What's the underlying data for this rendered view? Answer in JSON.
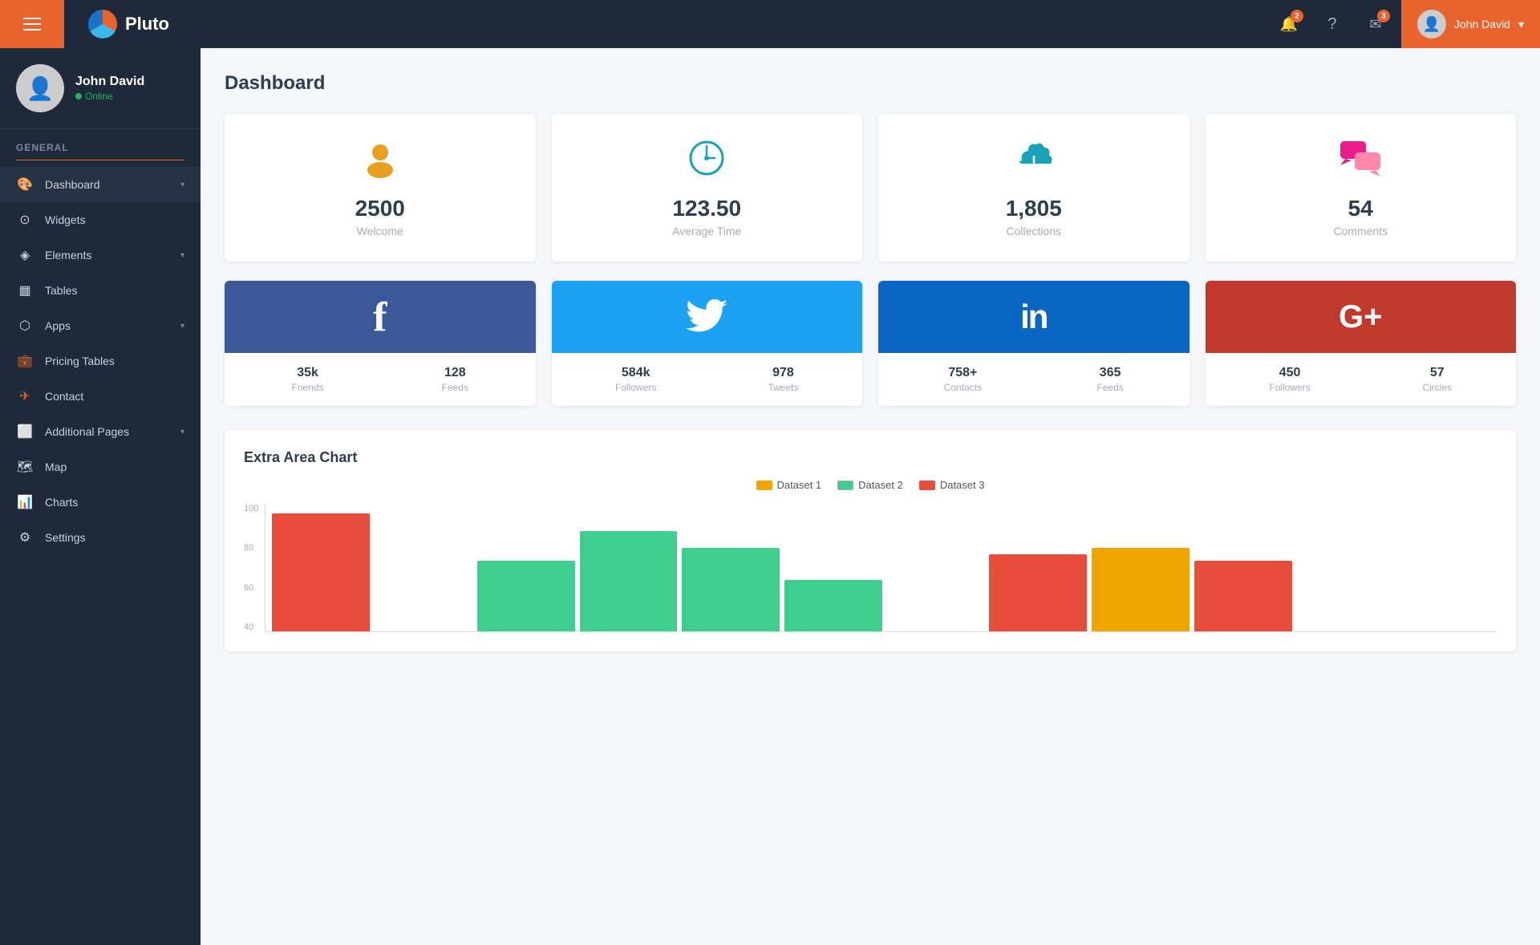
{
  "topbar": {
    "hamburger_label": "≡",
    "logo_text": "Pluto",
    "notifications_badge": "2",
    "messages_badge": "3",
    "user_name": "John David",
    "user_dropdown_arrow": "▾"
  },
  "sidebar": {
    "profile": {
      "username": "John David",
      "status": "Online"
    },
    "section_label": "General",
    "items": [
      {
        "id": "dashboard",
        "label": "Dashboard",
        "icon": "🎨",
        "has_arrow": true
      },
      {
        "id": "widgets",
        "label": "Widgets",
        "icon": "⊙"
      },
      {
        "id": "elements",
        "label": "Elements",
        "icon": "◈",
        "has_arrow": true
      },
      {
        "id": "tables",
        "label": "Tables",
        "icon": "▦"
      },
      {
        "id": "apps",
        "label": "Apps",
        "icon": "⬡",
        "has_arrow": true
      },
      {
        "id": "pricing-tables",
        "label": "Pricing Tables",
        "icon": "💼"
      },
      {
        "id": "contact",
        "label": "Contact",
        "icon": "✉"
      },
      {
        "id": "additional-pages",
        "label": "Additional Pages",
        "icon": "⬜",
        "has_arrow": true
      },
      {
        "id": "map",
        "label": "Map",
        "icon": "🗺"
      },
      {
        "id": "charts",
        "label": "Charts",
        "icon": "📊"
      },
      {
        "id": "settings",
        "label": "Settings",
        "icon": "⚙"
      }
    ]
  },
  "main": {
    "page_title": "Dashboard",
    "stat_cards": [
      {
        "id": "welcome",
        "value": "2500",
        "label": "Welcome",
        "icon": "👤",
        "color": "#e8a020"
      },
      {
        "id": "avg-time",
        "value": "123.50",
        "label": "Average Time",
        "icon": "⏱",
        "color": "#17a2b8"
      },
      {
        "id": "collections",
        "value": "1,805",
        "label": "Collections",
        "icon": "☁",
        "color": "#27ae60"
      },
      {
        "id": "comments",
        "value": "54",
        "label": "Comments",
        "icon": "💬",
        "color": "#e91e8c"
      }
    ],
    "social_cards": [
      {
        "id": "facebook",
        "bg": "#3b5998",
        "icon": "f",
        "stats": [
          {
            "value": "35k",
            "label": "Friends"
          },
          {
            "value": "128",
            "label": "Feeds"
          }
        ]
      },
      {
        "id": "twitter",
        "bg": "#1da1f2",
        "icon": "🐦",
        "stats": [
          {
            "value": "584k",
            "label": "Followers"
          },
          {
            "value": "978",
            "label": "Tweets"
          }
        ]
      },
      {
        "id": "linkedin",
        "bg": "#0a66c2",
        "icon": "in",
        "stats": [
          {
            "value": "758+",
            "label": "Contacts"
          },
          {
            "value": "365",
            "label": "Feeds"
          }
        ]
      },
      {
        "id": "googleplus",
        "bg": "#c0392b",
        "icon": "G+",
        "stats": [
          {
            "value": "450",
            "label": "Followers"
          },
          {
            "value": "57",
            "label": "Circles"
          }
        ]
      }
    ],
    "chart": {
      "title": "Extra Area Chart",
      "legend": [
        {
          "label": "Dataset 1",
          "color": "#f0a500"
        },
        {
          "label": "Dataset 2",
          "color": "#3ecf8e"
        },
        {
          "label": "Dataset 3",
          "color": "#e74c3c"
        }
      ],
      "y_labels": [
        "100",
        "80",
        "60",
        "40"
      ],
      "bar_groups": [
        {
          "bars": [
            0,
            0,
            95
          ]
        },
        {
          "bars": [
            0,
            0,
            0
          ]
        },
        {
          "bars": [
            0,
            65,
            0
          ]
        },
        {
          "bars": [
            0,
            80,
            0
          ]
        },
        {
          "bars": [
            0,
            70,
            0
          ]
        },
        {
          "bars": [
            0,
            50,
            0
          ]
        },
        {
          "bars": [
            0,
            0,
            0
          ]
        },
        {
          "bars": [
            0,
            0,
            65
          ]
        },
        {
          "bars": [
            0,
            0,
            0
          ]
        },
        {
          "bars": [
            70,
            0,
            0
          ]
        }
      ]
    }
  }
}
